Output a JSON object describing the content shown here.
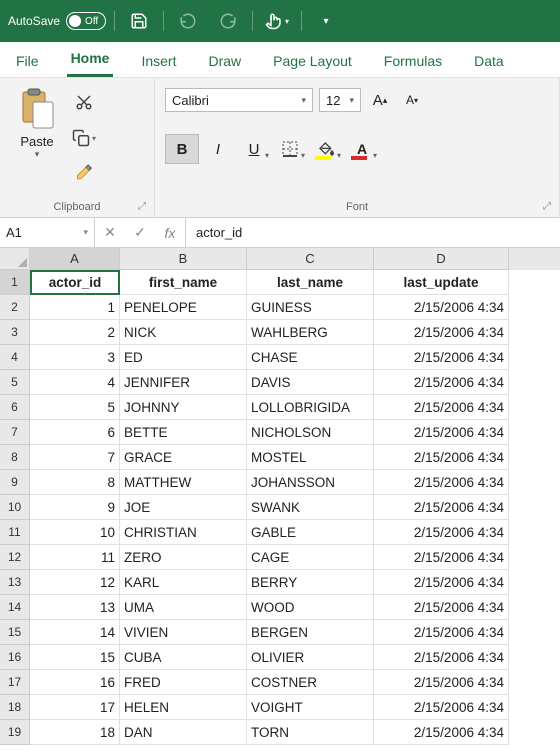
{
  "titlebar": {
    "autosave_label": "AutoSave",
    "autosave_state": "Off"
  },
  "menu": {
    "items": [
      "File",
      "Home",
      "Insert",
      "Draw",
      "Page Layout",
      "Formulas",
      "Data"
    ],
    "active": "Home"
  },
  "ribbon": {
    "clipboard": {
      "label": "Clipboard",
      "paste": "Paste"
    },
    "font": {
      "label": "Font",
      "name": "Calibri",
      "size": "12",
      "inc_tip": "A",
      "dec_tip": "A",
      "bold": "B",
      "italic": "I",
      "underline": "U"
    }
  },
  "formula_bar": {
    "cell_ref": "A1",
    "fx": "fx",
    "value": "actor_id"
  },
  "sheet": {
    "columns": [
      "A",
      "B",
      "C",
      "D"
    ],
    "col_widths": [
      "col-A",
      "col-B",
      "col-C",
      "col-D"
    ],
    "headers": [
      "actor_id",
      "first_name",
      "last_name",
      "last_update"
    ],
    "active_cell": "A1",
    "rows": [
      {
        "n": 1,
        "actor_id": "1",
        "first": "PENELOPE",
        "last": "GUINESS",
        "upd": "2/15/2006 4:34"
      },
      {
        "n": 2,
        "actor_id": "2",
        "first": "NICK",
        "last": "WAHLBERG",
        "upd": "2/15/2006 4:34"
      },
      {
        "n": 3,
        "actor_id": "3",
        "first": "ED",
        "last": "CHASE",
        "upd": "2/15/2006 4:34"
      },
      {
        "n": 4,
        "actor_id": "4",
        "first": "JENNIFER",
        "last": "DAVIS",
        "upd": "2/15/2006 4:34"
      },
      {
        "n": 5,
        "actor_id": "5",
        "first": "JOHNNY",
        "last": "LOLLOBRIGIDA",
        "upd": "2/15/2006 4:34"
      },
      {
        "n": 6,
        "actor_id": "6",
        "first": "BETTE",
        "last": "NICHOLSON",
        "upd": "2/15/2006 4:34"
      },
      {
        "n": 7,
        "actor_id": "7",
        "first": "GRACE",
        "last": "MOSTEL",
        "upd": "2/15/2006 4:34"
      },
      {
        "n": 8,
        "actor_id": "8",
        "first": "MATTHEW",
        "last": "JOHANSSON",
        "upd": "2/15/2006 4:34"
      },
      {
        "n": 9,
        "actor_id": "9",
        "first": "JOE",
        "last": "SWANK",
        "upd": "2/15/2006 4:34"
      },
      {
        "n": 10,
        "actor_id": "10",
        "first": "CHRISTIAN",
        "last": "GABLE",
        "upd": "2/15/2006 4:34"
      },
      {
        "n": 11,
        "actor_id": "11",
        "first": "ZERO",
        "last": "CAGE",
        "upd": "2/15/2006 4:34"
      },
      {
        "n": 12,
        "actor_id": "12",
        "first": "KARL",
        "last": "BERRY",
        "upd": "2/15/2006 4:34"
      },
      {
        "n": 13,
        "actor_id": "13",
        "first": "UMA",
        "last": "WOOD",
        "upd": "2/15/2006 4:34"
      },
      {
        "n": 14,
        "actor_id": "14",
        "first": "VIVIEN",
        "last": "BERGEN",
        "upd": "2/15/2006 4:34"
      },
      {
        "n": 15,
        "actor_id": "15",
        "first": "CUBA",
        "last": "OLIVIER",
        "upd": "2/15/2006 4:34"
      },
      {
        "n": 16,
        "actor_id": "16",
        "first": "FRED",
        "last": "COSTNER",
        "upd": "2/15/2006 4:34"
      },
      {
        "n": 17,
        "actor_id": "17",
        "first": "HELEN",
        "last": "VOIGHT",
        "upd": "2/15/2006 4:34"
      },
      {
        "n": 18,
        "actor_id": "18",
        "first": "DAN",
        "last": "TORN",
        "upd": "2/15/2006 4:34"
      }
    ]
  }
}
